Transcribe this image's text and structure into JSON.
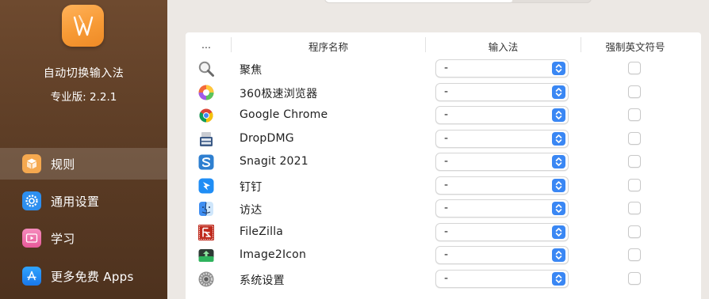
{
  "app": {
    "name": "自动切换输入法",
    "version": "专业版: 2.2.1"
  },
  "sidebar": {
    "items": [
      {
        "label": "规则",
        "icon": "cube-icon",
        "active": true,
        "color": "#f3a34b"
      },
      {
        "label": "通用设置",
        "icon": "gear-icon",
        "active": false,
        "color": "#2d8ff0"
      },
      {
        "label": "学习",
        "icon": "video-play-icon",
        "active": false,
        "color": "#f06aa8"
      },
      {
        "label": "更多免费 Apps",
        "icon": "app-store-icon",
        "active": false,
        "color": "#1d8cf2"
      }
    ]
  },
  "table": {
    "columns": [
      "...",
      "程序名称",
      "输入法",
      "强制英文符号"
    ],
    "rows": [
      {
        "name": "聚焦",
        "icon": "spotlight-search-icon",
        "input_method": "-",
        "force_english": false
      },
      {
        "name": "360极速浏览器",
        "icon": "360-browser-icon",
        "input_method": "-",
        "force_english": false
      },
      {
        "name": "Google Chrome",
        "icon": "chrome-icon",
        "input_method": "-",
        "force_english": false
      },
      {
        "name": "DropDMG",
        "icon": "dropdmg-icon",
        "input_method": "-",
        "force_english": false
      },
      {
        "name": "Snagit 2021",
        "icon": "snagit-icon",
        "input_method": "-",
        "force_english": false
      },
      {
        "name": "钉钉",
        "icon": "dingtalk-icon",
        "input_method": "-",
        "force_english": false
      },
      {
        "name": "访达",
        "icon": "finder-icon",
        "input_method": "-",
        "force_english": false
      },
      {
        "name": "FileZilla",
        "icon": "filezilla-icon",
        "input_method": "-",
        "force_english": false
      },
      {
        "name": "Image2Icon",
        "icon": "image2icon-icon",
        "input_method": "-",
        "force_english": false
      },
      {
        "name": "系统设置",
        "icon": "system-settings-icon",
        "input_method": "-",
        "force_english": false
      }
    ]
  },
  "colors": {
    "sidebar_bg": "#5e3f27",
    "accent_blue": "#3a87f4",
    "logo_orange": "#f79a35"
  }
}
